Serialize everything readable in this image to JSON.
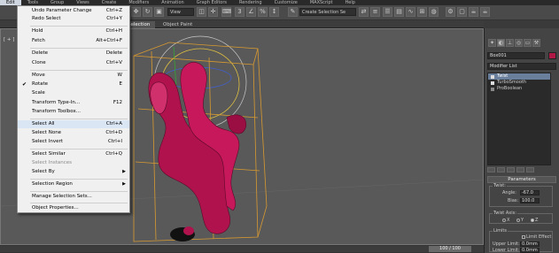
{
  "menubar": {
    "items": [
      "Edit",
      "Tools",
      "Group",
      "Views",
      "Create",
      "Modifiers",
      "Animation",
      "Graph Editors",
      "Rendering",
      "Customize",
      "MAXScript",
      "Help"
    ]
  },
  "toolbar": {
    "view_dropdown": "View",
    "selection_set": "Create Selection Se"
  },
  "ribbon": {
    "tabs": [
      "Selection",
      "Object Paint"
    ],
    "selected": "Selection"
  },
  "viewport": {
    "label": "[ + ]"
  },
  "timeline": {
    "slider": "100 / 100"
  },
  "panel": {
    "object_name": "Box001",
    "color": "#b01846",
    "modifier_list": "Modifier List",
    "stack": [
      {
        "label": "Twist",
        "selected": true,
        "sub": false
      },
      {
        "label": "TurboSmooth",
        "selected": false,
        "sub": false
      },
      {
        "label": "ProBoolean",
        "selected": false,
        "sub": true
      }
    ],
    "rollout_title": "Parameters",
    "twist": {
      "title": "Twist:",
      "angle_label": "Angle:",
      "angle_value": "-67.0",
      "bias_label": "Bias:",
      "bias_value": "100.0"
    },
    "twist_axis": {
      "title": "Twist Axis:",
      "options": [
        "X",
        "Y",
        "Z"
      ],
      "selected": "Z"
    },
    "limits": {
      "title": "Limits",
      "limit_effect": "Limit Effect",
      "upper_label": "Upper Limit:",
      "upper_value": "0.0mm",
      "lower_label": "Lower Limit:",
      "lower_value": "0.0mm"
    }
  },
  "edit_menu": {
    "items": [
      {
        "label": "Undo Parameter Change",
        "shortcut": "Ctrl+Z",
        "disabled": false
      },
      {
        "label": "Redo Select",
        "shortcut": "Ctrl+Y",
        "disabled": false
      },
      {
        "label": "Hold",
        "shortcut": "Ctrl+H",
        "disabled": false
      },
      {
        "label": "Fetch",
        "shortcut": "Alt+Ctrl+F",
        "disabled": false
      },
      {
        "label": "Delete",
        "shortcut": "Delete",
        "disabled": false
      },
      {
        "label": "Clone",
        "shortcut": "Ctrl+V",
        "disabled": false
      },
      {
        "label": "Move",
        "shortcut": "W",
        "disabled": false
      },
      {
        "label": "Rotate",
        "shortcut": "E",
        "disabled": false,
        "checked": true
      },
      {
        "label": "Scale",
        "shortcut": "",
        "disabled": false
      },
      {
        "label": "Transform Type-In...",
        "shortcut": "F12",
        "disabled": false
      },
      {
        "label": "Transform Toolbox...",
        "shortcut": "",
        "disabled": false
      },
      {
        "label": "Select All",
        "shortcut": "Ctrl+A",
        "disabled": false,
        "highlighted": true
      },
      {
        "label": "Select None",
        "shortcut": "Ctrl+D",
        "disabled": false
      },
      {
        "label": "Select Invert",
        "shortcut": "Ctrl+I",
        "disabled": false
      },
      {
        "label": "Select Similar",
        "shortcut": "Ctrl+Q",
        "disabled": false
      },
      {
        "label": "Select Instances",
        "shortcut": "",
        "disabled": true
      },
      {
        "label": "Select By",
        "shortcut": "",
        "disabled": false,
        "submenu": true
      },
      {
        "label": "Selection Region",
        "shortcut": "",
        "disabled": false,
        "submenu": true
      },
      {
        "label": "Manage Selection Sets...",
        "shortcut": "",
        "disabled": false
      },
      {
        "label": "Object Properties...",
        "shortcut": "",
        "disabled": false
      }
    ]
  }
}
